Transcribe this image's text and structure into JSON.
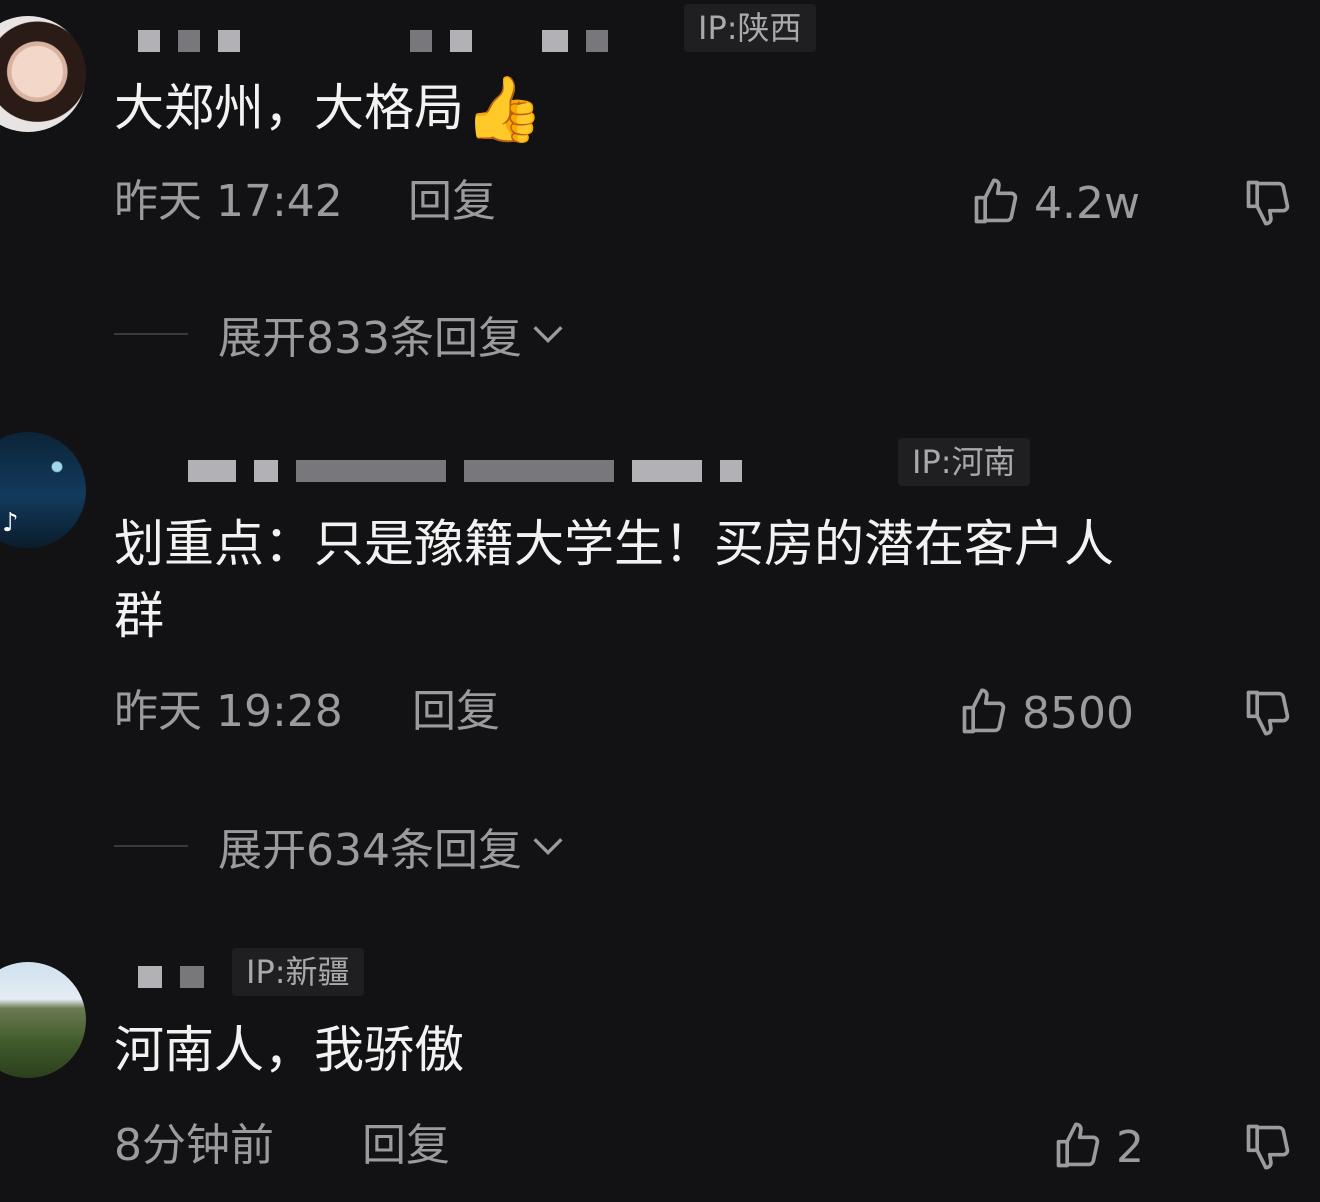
{
  "comments": [
    {
      "ip": "IP:陕西",
      "text": "大郑州，大格局",
      "emoji": "👍",
      "time": "昨天 17:42",
      "reply": "回复",
      "likes": "4.2w",
      "expand": "展开833条回复"
    },
    {
      "ip": "IP:河南",
      "text_line1": "划重点：只是豫籍大学生！买房的潜在客户人",
      "text_line2": "群",
      "avatar_badge": "♪",
      "time": "昨天 19:28",
      "reply": "回复",
      "likes": "8500",
      "expand": "展开634条回复"
    },
    {
      "ip": "IP:新疆",
      "text": "河南人，我骄傲",
      "time": "8分钟前",
      "reply": "回复",
      "likes": "2"
    }
  ],
  "icons": {
    "like": "thumbs-up-outline-icon",
    "dislike": "thumbs-down-outline-icon",
    "expand": "chevron-down-icon"
  },
  "colors": {
    "background": "#121214",
    "primary_text": "#f2f2f3",
    "secondary_text": "#9b9b9f",
    "ip_badge_bg": "#1f1f22"
  }
}
